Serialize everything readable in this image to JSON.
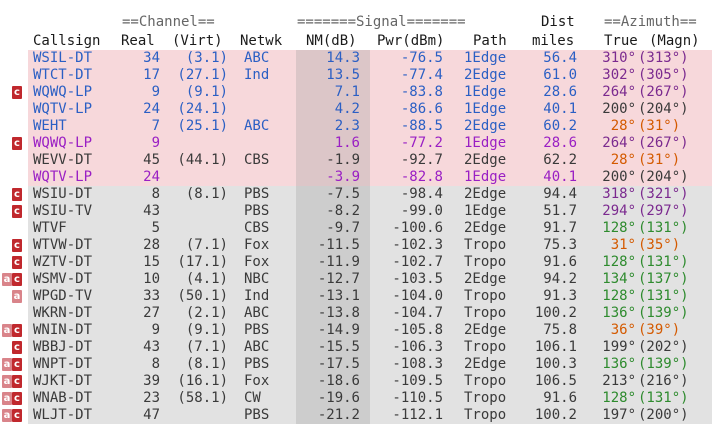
{
  "header": {
    "channel_group": "==Channel==",
    "signal_group": "=======Signal=======",
    "dist_top": "Dist",
    "azimuth_group": "==Azimuth==",
    "col_callsign": "Callsign",
    "col_real": "Real",
    "col_virt": "(Virt)",
    "col_netwk": "Netwk",
    "col_nm": "NM(dB)",
    "col_pwr": "Pwr(dBm)",
    "col_path": "Path",
    "col_miles": "miles",
    "col_true": "True",
    "col_magn": "(Magn)"
  },
  "colors": {
    "blue_text": "#2b5fc4",
    "purple_text": "#9a1fc4",
    "gray_text": "#3a3a3a",
    "pink_bg": "#f7d8db",
    "blue_bg": "#dbe7f5",
    "gray_bg": "#e2e2e2",
    "azimuth_green": "#2e8b2e",
    "azimuth_purple": "#7b2a8f",
    "azimuth_orange": "#d45a00",
    "tag_red": "#c0282d",
    "tag_pink": "#d9848a"
  },
  "rows": [
    {
      "tags": [],
      "callsign": "WSIL-DT",
      "real": "34",
      "virt": "(3.1)",
      "netwk": "ABC",
      "nm": "14.3",
      "pwr": "-76.5",
      "path": "1Edge",
      "miles": "56.4",
      "true_az": "310°",
      "magn": "(313°)",
      "style": "blue",
      "az": "purple"
    },
    {
      "tags": [],
      "callsign": "WTCT-DT",
      "real": "17",
      "virt": "(27.1)",
      "netwk": "Ind",
      "nm": "13.5",
      "pwr": "-77.4",
      "path": "2Edge",
      "miles": "61.0",
      "true_az": "302°",
      "magn": "(305°)",
      "style": "blue",
      "az": "purple"
    },
    {
      "tags": [
        "c"
      ],
      "callsign": "WQWQ-LP",
      "real": "9",
      "virt": "(9.1)",
      "netwk": "",
      "nm": "7.1",
      "pwr": "-83.8",
      "path": "1Edge",
      "miles": "28.6",
      "true_az": "264°",
      "magn": "(267°)",
      "style": "blue",
      "az": "purple"
    },
    {
      "tags": [],
      "callsign": "WQTV-LP",
      "real": "24",
      "virt": "(24.1)",
      "netwk": "",
      "nm": "4.2",
      "pwr": "-86.6",
      "path": "1Edge",
      "miles": "40.1",
      "true_az": "200°",
      "magn": "(204°)",
      "style": "blue",
      "az": "gray"
    },
    {
      "tags": [],
      "callsign": "WEHT",
      "real": "7",
      "virt": "(25.1)",
      "netwk": "ABC",
      "nm": "2.3",
      "pwr": "-88.5",
      "path": "2Edge",
      "miles": "60.2",
      "true_az": "28°",
      "magn": "(31°)",
      "style": "blue",
      "az": "orange"
    },
    {
      "tags": [
        "c"
      ],
      "callsign": "WQWQ-LP",
      "real": "9",
      "virt": "",
      "netwk": "",
      "nm": "1.6",
      "pwr": "-77.2",
      "path": "1Edge",
      "miles": "28.6",
      "true_az": "264°",
      "magn": "(267°)",
      "style": "purple",
      "az": "purple"
    },
    {
      "tags": [],
      "callsign": "WEVV-DT",
      "real": "45",
      "virt": "(44.1)",
      "netwk": "CBS",
      "nm": "-1.9",
      "pwr": "-92.7",
      "path": "2Edge",
      "miles": "62.2",
      "true_az": "28°",
      "magn": "(31°)",
      "style": "gray_pink",
      "az": "orange"
    },
    {
      "tags": [],
      "callsign": "WQTV-LP",
      "real": "24",
      "virt": "",
      "netwk": "",
      "nm": "-3.9",
      "pwr": "-82.8",
      "path": "1Edge",
      "miles": "40.1",
      "true_az": "200°",
      "magn": "(204°)",
      "style": "purple",
      "az": "gray"
    },
    {
      "tags": [
        "c"
      ],
      "callsign": "WSIU-DT",
      "real": "8",
      "virt": "(8.1)",
      "netwk": "PBS",
      "nm": "-7.5",
      "pwr": "-98.4",
      "path": "2Edge",
      "miles": "94.4",
      "true_az": "318°",
      "magn": "(321°)",
      "style": "gray",
      "az": "purple"
    },
    {
      "tags": [
        "c"
      ],
      "callsign": "WSIU-TV",
      "real": "43",
      "virt": "",
      "netwk": "PBS",
      "nm": "-8.2",
      "pwr": "-99.0",
      "path": "1Edge",
      "miles": "51.7",
      "true_az": "294°",
      "magn": "(297°)",
      "style": "gray",
      "az": "purple"
    },
    {
      "tags": [],
      "callsign": "WTVF",
      "real": "5",
      "virt": "",
      "netwk": "CBS",
      "nm": "-9.7",
      "pwr": "-100.6",
      "path": "2Edge",
      "miles": "91.7",
      "true_az": "128°",
      "magn": "(131°)",
      "style": "gray",
      "az": "green"
    },
    {
      "tags": [
        "c"
      ],
      "callsign": "WTVW-DT",
      "real": "28",
      "virt": "(7.1)",
      "netwk": "Fox",
      "nm": "-11.5",
      "pwr": "-102.3",
      "path": "Tropo",
      "miles": "75.3",
      "true_az": "31°",
      "magn": "(35°)",
      "style": "gray",
      "az": "orange"
    },
    {
      "tags": [
        "c"
      ],
      "callsign": "WZTV-DT",
      "real": "15",
      "virt": "(17.1)",
      "netwk": "Fox",
      "nm": "-11.9",
      "pwr": "-102.7",
      "path": "Tropo",
      "miles": "91.6",
      "true_az": "128°",
      "magn": "(131°)",
      "style": "gray",
      "az": "green"
    },
    {
      "tags": [
        "a",
        "c"
      ],
      "callsign": "WSMV-DT",
      "real": "10",
      "virt": "(4.1)",
      "netwk": "NBC",
      "nm": "-12.7",
      "pwr": "-103.5",
      "path": "2Edge",
      "miles": "94.2",
      "true_az": "134°",
      "magn": "(137°)",
      "style": "gray",
      "az": "green"
    },
    {
      "tags": [
        "a"
      ],
      "callsign": "WPGD-TV",
      "real": "33",
      "virt": "(50.1)",
      "netwk": "Ind",
      "nm": "-13.1",
      "pwr": "-104.0",
      "path": "Tropo",
      "miles": "91.3",
      "true_az": "128°",
      "magn": "(131°)",
      "style": "gray",
      "az": "green"
    },
    {
      "tags": [],
      "callsign": "WKRN-DT",
      "real": "27",
      "virt": "(2.1)",
      "netwk": "ABC",
      "nm": "-13.8",
      "pwr": "-104.7",
      "path": "Tropo",
      "miles": "100.2",
      "true_az": "136°",
      "magn": "(139°)",
      "style": "gray",
      "az": "green"
    },
    {
      "tags": [
        "a",
        "c"
      ],
      "callsign": "WNIN-DT",
      "real": "9",
      "virt": "(9.1)",
      "netwk": "PBS",
      "nm": "-14.9",
      "pwr": "-105.8",
      "path": "2Edge",
      "miles": "75.8",
      "true_az": "36°",
      "magn": "(39°)",
      "style": "gray",
      "az": "orange"
    },
    {
      "tags": [
        "c"
      ],
      "callsign": "WBBJ-DT",
      "real": "43",
      "virt": "(7.1)",
      "netwk": "ABC",
      "nm": "-15.5",
      "pwr": "-106.3",
      "path": "Tropo",
      "miles": "106.1",
      "true_az": "199°",
      "magn": "(202°)",
      "style": "gray",
      "az": "gray"
    },
    {
      "tags": [
        "a",
        "c"
      ],
      "callsign": "WNPT-DT",
      "real": "8",
      "virt": "(8.1)",
      "netwk": "PBS",
      "nm": "-17.5",
      "pwr": "-108.3",
      "path": "2Edge",
      "miles": "100.3",
      "true_az": "136°",
      "magn": "(139°)",
      "style": "gray",
      "az": "green"
    },
    {
      "tags": [
        "a",
        "c"
      ],
      "callsign": "WJKT-DT",
      "real": "39",
      "virt": "(16.1)",
      "netwk": "Fox",
      "nm": "-18.6",
      "pwr": "-109.5",
      "path": "Tropo",
      "miles": "106.5",
      "true_az": "213°",
      "magn": "(216°)",
      "style": "gray",
      "az": "gray"
    },
    {
      "tags": [
        "a",
        "c"
      ],
      "callsign": "WNAB-DT",
      "real": "23",
      "virt": "(58.1)",
      "netwk": "CW",
      "nm": "-19.6",
      "pwr": "-110.5",
      "path": "Tropo",
      "miles": "91.6",
      "true_az": "128°",
      "magn": "(131°)",
      "style": "gray",
      "az": "green"
    },
    {
      "tags": [
        "a",
        "c"
      ],
      "callsign": "WLJT-DT",
      "real": "47",
      "virt": "",
      "netwk": "PBS",
      "nm": "-21.2",
      "pwr": "-112.1",
      "path": "Tropo",
      "miles": "100.2",
      "true_az": "197°",
      "magn": "(200°)",
      "style": "gray",
      "az": "gray"
    }
  ]
}
